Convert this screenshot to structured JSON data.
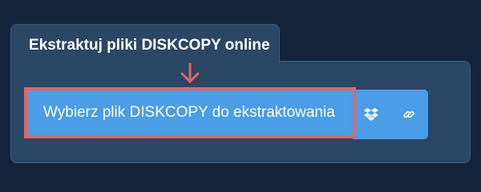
{
  "tab": {
    "title": "Ekstraktuj pliki DISKCOPY online"
  },
  "upload": {
    "label": "Wybierz plik DISKCOPY do ekstraktowania"
  },
  "icons": {
    "arrow": "arrow-down-icon",
    "dropbox": "dropbox-icon",
    "link": "link-icon"
  },
  "colors": {
    "background": "#13243a",
    "panel": "#2c4665",
    "button": "#4a9de6",
    "highlight_border": "#e06666"
  }
}
